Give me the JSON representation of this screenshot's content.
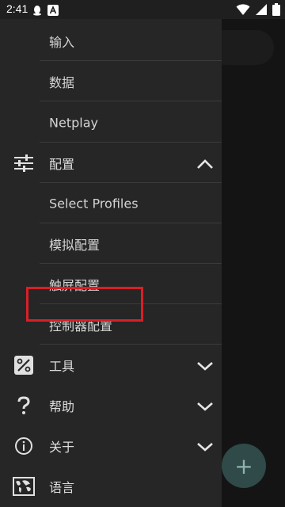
{
  "status_bar": {
    "time": "2:41",
    "left_icons": [
      "qq-icon",
      "font-a-icon"
    ],
    "right_icons": [
      "wifi-icon",
      "signal-icon",
      "battery-icon"
    ]
  },
  "drawer": {
    "items": [
      {
        "label": "输入",
        "type": "sub"
      },
      {
        "label": "数据",
        "type": "sub"
      },
      {
        "label": "Netplay",
        "type": "sub"
      },
      {
        "label": "配置",
        "type": "section",
        "icon": "sliders-icon",
        "expanded": true
      },
      {
        "label": "Select Profiles",
        "type": "sub"
      },
      {
        "label": "模拟配置",
        "type": "sub"
      },
      {
        "label": "触屏配置",
        "type": "sub"
      },
      {
        "label": "控制器配置",
        "type": "sub",
        "highlighted": true
      },
      {
        "label": "工具",
        "type": "section",
        "icon": "tools-icon",
        "expanded": false
      },
      {
        "label": "帮助",
        "type": "section",
        "icon": "help-icon",
        "expanded": false
      },
      {
        "label": "关于",
        "type": "section",
        "icon": "info-icon",
        "expanded": false
      },
      {
        "label": "语言",
        "type": "section",
        "icon": "globe-map-icon",
        "expanded": false
      }
    ]
  },
  "fab": {
    "symbol": "+"
  },
  "colors": {
    "drawer_bg": "#262626",
    "highlight": "#d91f26",
    "fab_bg": "#2f4a48"
  }
}
